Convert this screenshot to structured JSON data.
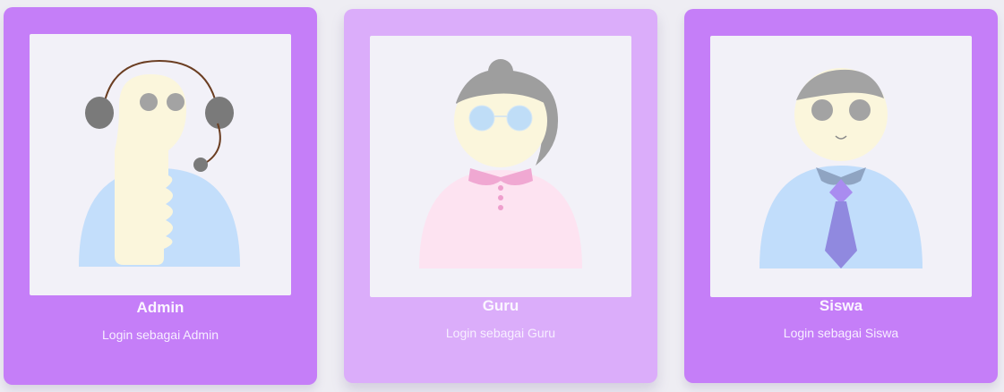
{
  "cards": [
    {
      "id": "admin",
      "title": "Admin",
      "subtitle": "Login sebagai Admin",
      "avatar_icon": "admin-avatar-icon",
      "bg": "#c57ef8"
    },
    {
      "id": "guru",
      "title": "Guru",
      "subtitle": "Login sebagai Guru",
      "avatar_icon": "teacher-avatar-icon",
      "bg": "#dbadfa"
    },
    {
      "id": "siswa",
      "title": "Siswa",
      "subtitle": "Login sebagai Siswa",
      "avatar_icon": "student-avatar-icon",
      "bg": "#c57ef8"
    }
  ]
}
